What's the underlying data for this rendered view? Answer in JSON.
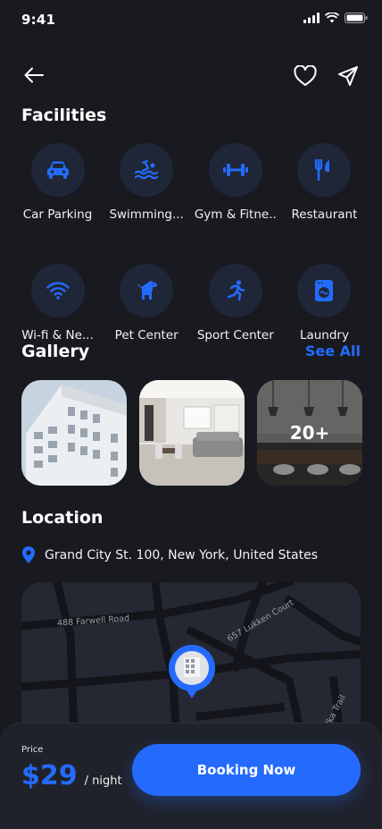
{
  "status_bar": {
    "time": "9:41"
  },
  "facilities": {
    "title": "Facilities",
    "items": [
      {
        "label": "Car Parking",
        "icon": "car-icon"
      },
      {
        "label": "Swimming...",
        "icon": "swimming-icon"
      },
      {
        "label": "Gym & Fitne..",
        "icon": "dumbbell-icon"
      },
      {
        "label": "Restaurant",
        "icon": "fork-knife-icon"
      },
      {
        "label": "Wi-fi & Ne...",
        "icon": "wifi-icon"
      },
      {
        "label": "Pet Center",
        "icon": "dog-icon"
      },
      {
        "label": "Sport Center",
        "icon": "running-icon"
      },
      {
        "label": "Laundry",
        "icon": "washing-machine-icon"
      }
    ]
  },
  "gallery": {
    "title": "Gallery",
    "see_all": "See All",
    "more_count": "20+"
  },
  "location": {
    "title": "Location",
    "address": "Grand City St. 100, New York, United States",
    "map_labels": {
      "road1": "488 Farwell Road",
      "road2": "657 Lukken Court",
      "road3": "Elka Trail"
    }
  },
  "booking": {
    "price_label": "Price",
    "price": "$29",
    "unit": "/ night",
    "button": "Booking Now"
  },
  "colors": {
    "accent": "#246bfd",
    "background": "#181a20",
    "icon_bg": "#1f2638"
  }
}
